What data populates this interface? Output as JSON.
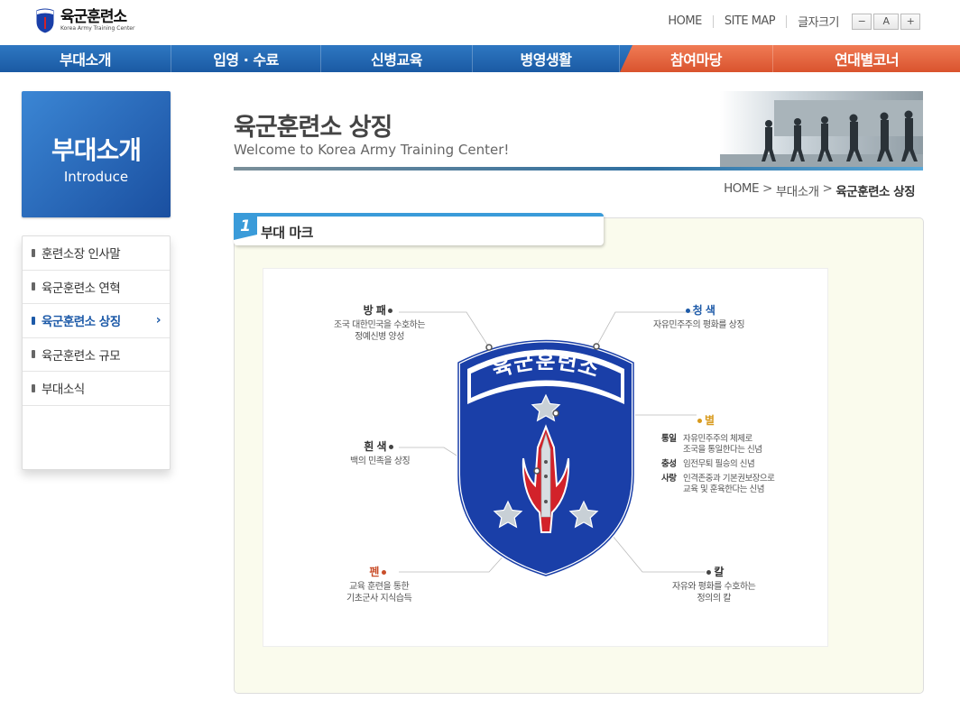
{
  "header": {
    "logo_ko": "육군훈련소",
    "logo_en": "Korea Army Training Center",
    "util": {
      "home": "HOME",
      "sitemap": "SITE MAP",
      "font_size": "글자크기",
      "minus": "−",
      "a": "A",
      "plus": "+"
    }
  },
  "gnb": [
    "부대소개",
    "입영 · 수료",
    "신병교육",
    "병영생활",
    "참여마당",
    "연대별코너"
  ],
  "lnb": {
    "title_ko": "부대소개",
    "title_en": "Introduce",
    "items": [
      {
        "label": "훈련소장 인사말"
      },
      {
        "label": "육군훈련소 연혁"
      },
      {
        "label": "육군훈련소 상징",
        "active": true
      },
      {
        "label": "육군훈련소 규모"
      },
      {
        "label": "부대소식"
      }
    ],
    "active_arrow": "›"
  },
  "page": {
    "title": "육군훈련소 상징",
    "subtitle": "Welcome to Korea Army Training Center!"
  },
  "breadcrumb": {
    "home": "HOME",
    "level1": "부대소개",
    "current": "육군훈련소 상징",
    "gt": ">"
  },
  "section": {
    "number": "1",
    "label": "부대 마크"
  },
  "emblem": {
    "banner": "육군훈련소",
    "annotations": {
      "shield": {
        "title": "방 패",
        "desc1": "조국 대한민국을 수호하는",
        "desc2": "정예신병 양성"
      },
      "blue": {
        "title": "청 색",
        "desc1": "자유민주주의 평화를 상징"
      },
      "white": {
        "title": "흰 색",
        "desc1": "백의 민족을 상징"
      },
      "star": {
        "title": "별",
        "rows": [
          {
            "k": "통일",
            "v1": "자유민주주의 체제로",
            "v2": "조국을 통일한다는 신념"
          },
          {
            "k": "충성",
            "v1": "임전무퇴 필승의 신념",
            "v2": ""
          },
          {
            "k": "사랑",
            "v1": "인격존중과 기본권보장으로",
            "v2": "교육 및 훈육한다는 신념"
          }
        ]
      },
      "pen": {
        "title": "펜",
        "desc1": "교육 훈련을 통한",
        "desc2": "기초군사 지식습득"
      },
      "sword": {
        "title": "칼",
        "desc1": "자유와 평화를 수호하는",
        "desc2": "정의의 칼"
      }
    }
  },
  "colors": {
    "nav_blue": "#1f63ad",
    "nav_orange": "#e2623a",
    "accent": "#3a9bd9",
    "emblem_blue": "#1a3fa8",
    "sword_red": "#d2222a"
  }
}
